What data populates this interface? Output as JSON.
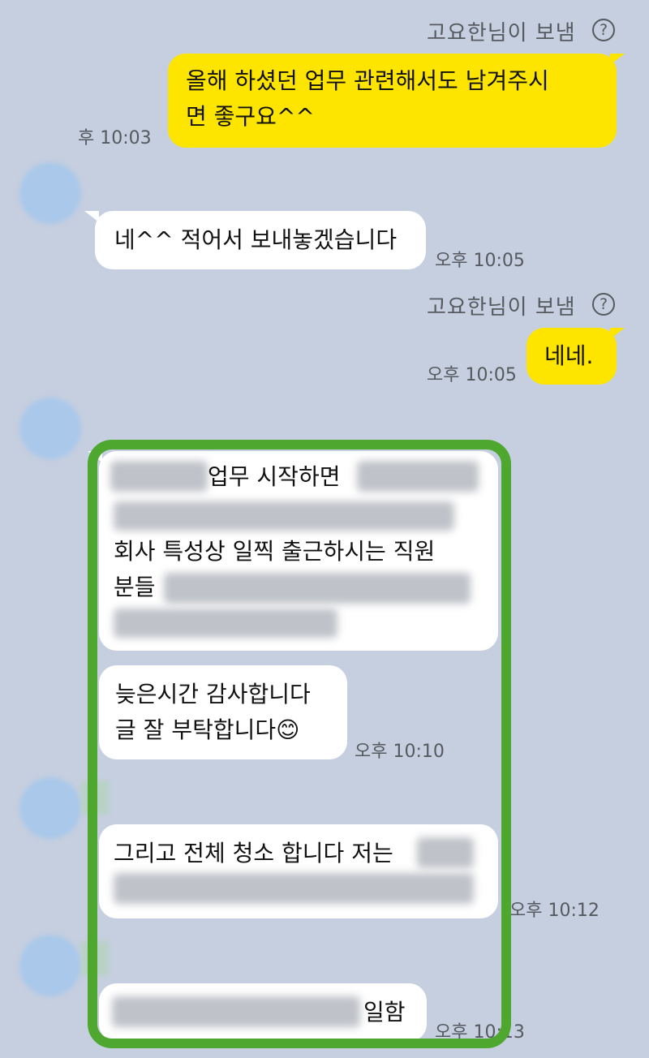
{
  "messages": {
    "m1": {
      "sender": "고요한님이 보냄",
      "lines": [
        "올해 하셨던 업무 관련해서도 남겨주시",
        "면 좋구요^^"
      ],
      "time": "후 10:03"
    },
    "m2": {
      "text": "네^^ 적어서 보내놓겠습니다",
      "time": "오후 10:05"
    },
    "m3": {
      "sender": "고요한님이 보냄",
      "text": "네네.",
      "time": "오후 10:05"
    },
    "m4": {
      "line1": "업무 시작하면",
      "line3": "회사 특성상 일찍 출근하시는 직원",
      "line4": "분들"
    },
    "m5": {
      "line1": "늦은시간 감사합니다",
      "line2": "글 잘 부탁합니다😊",
      "time": "오후 10:10"
    },
    "m6": {
      "line1": "그리고 전체 청소 합니다 저는",
      "time": "오후 10:12"
    },
    "m7": {
      "text_end": "일함",
      "time": "오후 10:13"
    }
  },
  "icons": {
    "help": "?"
  },
  "colors": {
    "background": "#c6cfdf",
    "my_bubble": "#fee500",
    "other_bubble": "#ffffff",
    "highlight_border": "#4ea72e"
  }
}
